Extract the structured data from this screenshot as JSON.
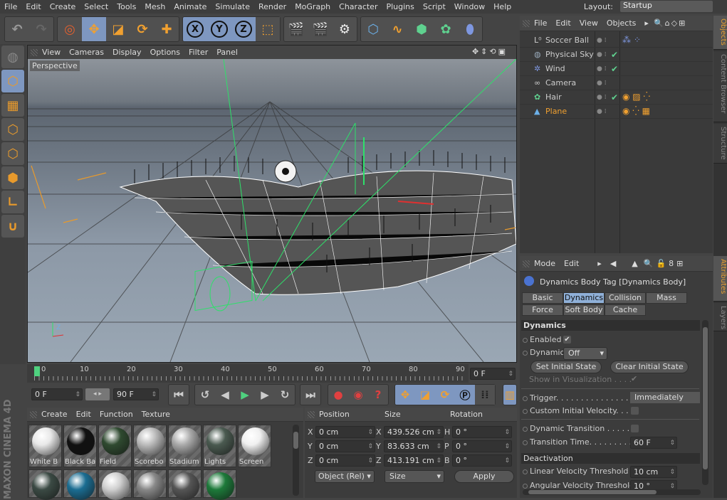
{
  "menu": [
    "File",
    "Edit",
    "Create",
    "Select",
    "Tools",
    "Mesh",
    "Animate",
    "Simulate",
    "Render",
    "MoGraph",
    "Character",
    "Plugins",
    "Script",
    "Window",
    "Help"
  ],
  "layout": {
    "label": "Layout:",
    "value": "Startup"
  },
  "toolbar": {
    "axes": [
      "X",
      "Y",
      "Z"
    ]
  },
  "viewport": {
    "menu": [
      "View",
      "Cameras",
      "Display",
      "Options",
      "Filter",
      "Panel"
    ],
    "camera_label": "Perspective"
  },
  "timeline": {
    "ticks": [
      "0",
      "10",
      "20",
      "30",
      "40",
      "50",
      "60",
      "70",
      "80",
      "90"
    ],
    "current_frame": "0 F",
    "start": "0 F",
    "end": "90 F"
  },
  "materials": {
    "menu": [
      "Create",
      "Edit",
      "Function",
      "Texture"
    ],
    "items": [
      {
        "name": "White B",
        "color": "#e8e8e8"
      },
      {
        "name": "Black Ba",
        "color": "#111111"
      },
      {
        "name": "Field",
        "color": "#2f4a30"
      },
      {
        "name": "Scorebo",
        "color": "#bbbbbb"
      },
      {
        "name": "Stadium",
        "color": "#aaaaaa"
      },
      {
        "name": "Lights",
        "color": "#4a5a50"
      },
      {
        "name": "Screen",
        "color": "#f0f0f0"
      }
    ],
    "row2_colors": [
      "#3b4a44",
      "#1b6d92",
      "#cfcfcf",
      "#888888",
      "#555555",
      "#1d7a3a"
    ]
  },
  "coordinates": {
    "headers": [
      "Position",
      "Size",
      "Rotation"
    ],
    "position": [
      {
        "axis": "X",
        "value": "0 cm"
      },
      {
        "axis": "Y",
        "value": "0 cm"
      },
      {
        "axis": "Z",
        "value": "0 cm"
      }
    ],
    "size": [
      {
        "axis": "X",
        "value": "439.526 cm"
      },
      {
        "axis": "Y",
        "value": "83.633 cm"
      },
      {
        "axis": "Z",
        "value": "413.191 cm"
      }
    ],
    "rotation": [
      {
        "axis": "H",
        "value": "0 °"
      },
      {
        "axis": "P",
        "value": "0 °"
      },
      {
        "axis": "B",
        "value": "0 °"
      }
    ],
    "mode": "Object (Rel)",
    "size_mode": "Size",
    "apply": "Apply"
  },
  "objects": {
    "menu": [
      "File",
      "Edit",
      "View",
      "Objects"
    ],
    "items": [
      {
        "name": "Soccer Ball",
        "icon": "null-icon",
        "check": ""
      },
      {
        "name": "Physical Sky",
        "icon": "sky-icon",
        "check": "✔"
      },
      {
        "name": "Wind",
        "icon": "wind-icon",
        "check": "✔"
      },
      {
        "name": "Camera",
        "icon": "camera-icon",
        "check": ""
      },
      {
        "name": "Hair",
        "icon": "hair-icon",
        "check": "✔"
      },
      {
        "name": "Plane",
        "icon": "plane-icon",
        "check": "",
        "selected": true
      }
    ]
  },
  "side_tabs": [
    "Objects",
    "Content Browser",
    "Structure",
    "Attributes",
    "Layers"
  ],
  "attributes": {
    "menu": [
      "Mode",
      "Edit"
    ],
    "title": "Dynamics Body Tag [Dynamics Body]",
    "tabs": [
      "Basic",
      "Dynamics",
      "Collision",
      "Mass",
      "Force",
      "Soft Body",
      "Cache"
    ],
    "active_tab": "Dynamics",
    "section1": "Dynamics",
    "enabled": "Enabled",
    "dynamic": "Dynamic",
    "dynamic_value": "Off",
    "set_initial": "Set Initial State",
    "clear_initial": "Clear Initial State",
    "show_vis": "Show in Visualization . . . .",
    "trigger": "Trigger. . . . . . . . . . . . . . . . .",
    "trigger_value": "Immediately",
    "custom_vel": "Custom Initial Velocity. . . .",
    "dyn_trans": "Dynamic Transition  . . . . . .",
    "trans_time": "Transition Time. . . . . . . . . .",
    "trans_time_value": "60 F",
    "section2": "Deactivation",
    "lin_vel": "Linear Velocity Threshold",
    "lin_vel_value": "10 cm",
    "ang_vel": "Angular Velocity Threshold",
    "ang_vel_value": "10 °"
  },
  "brand": "MAXON CINEMA 4D"
}
